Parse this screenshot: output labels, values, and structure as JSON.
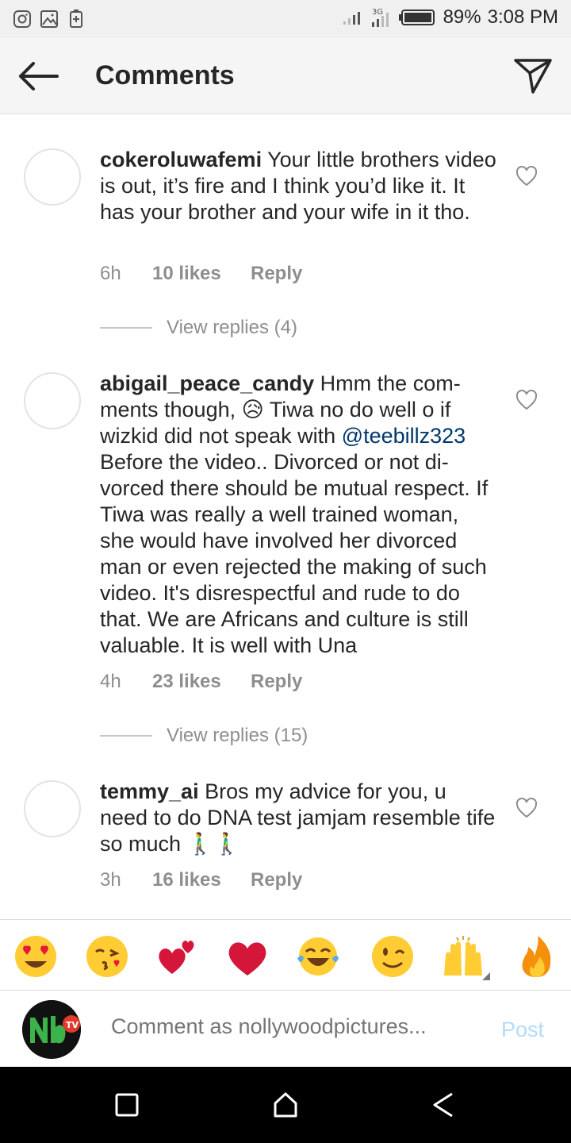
{
  "status_bar": {
    "network": "3G",
    "battery": "89%",
    "time": "3:08 PM"
  },
  "header": {
    "title": "Comments"
  },
  "comments": [
    {
      "username": "cokeroluwafemi",
      "text": "Your little brothers video is out, it’s fire and I think you’d like it. It has your brother and your wife in it tho.",
      "time": "6h",
      "likes": "10 likes",
      "reply": "Reply",
      "view_replies": "View replies (4)"
    },
    {
      "username": "abigail_peace_candy",
      "text_before_mention": "Hmm the com-ments though, 😥 Tiwa no do well o if wizkid did not speak with ",
      "mention": "@teebillz323",
      "text_after_mention": " Before the video.. Divorced or not di-vorced there should be mutual respect. If Tiwa was really a well trained woman, she would have involved her divorced man or even rejected the making of such video. It's disrespectful and rude to do that. We are Africans and culture is still valuable. It is well with Una",
      "time": "4h",
      "likes": "23 likes",
      "reply": "Reply",
      "view_replies": "View replies (15)"
    },
    {
      "username": "temmy_ai",
      "text": "Bros my advice for you, u need to do DNA test jamjam resemble tife so much 🚶‍♂️🚶‍♂️",
      "time": "3h",
      "likes": "16 likes",
      "reply": "Reply"
    }
  ],
  "emoji_bar": {
    "emojis": [
      "heart-eyes",
      "kissing-heart",
      "two-hearts",
      "red-heart",
      "tears-of-joy",
      "winking",
      "raising-hands",
      "fire"
    ]
  },
  "input": {
    "placeholder": "Comment as nollywoodpictures...",
    "post_label": "Post",
    "avatar_text": "TV"
  },
  "colors": {
    "mention": "#00376b",
    "muted": "#8e8e8e",
    "post_disabled": "#b3dbff"
  }
}
